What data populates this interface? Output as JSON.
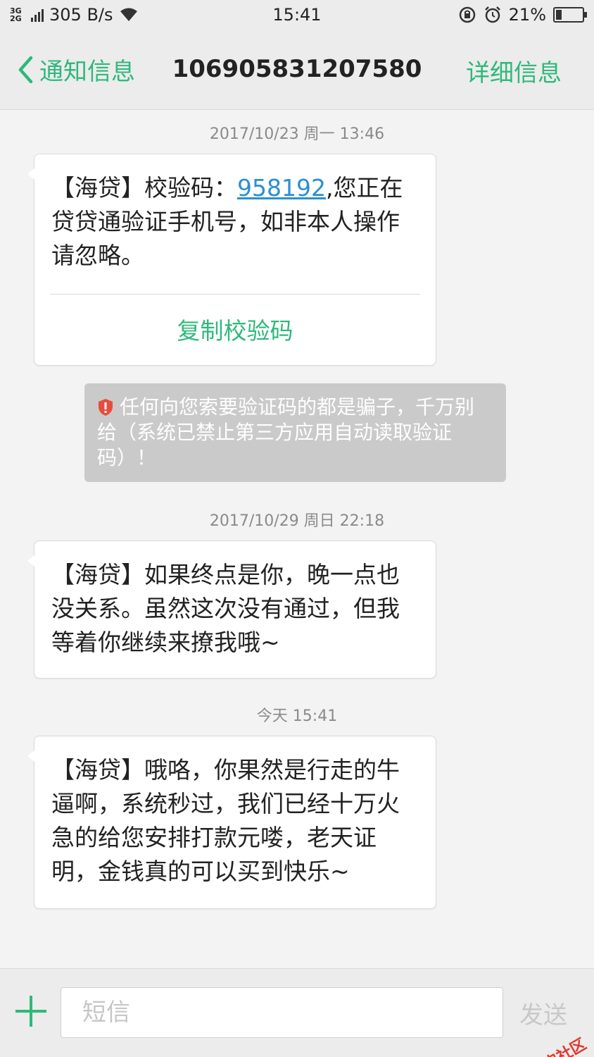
{
  "status_bar": {
    "network_top": "3G",
    "network_bottom": "2G",
    "speed": "305 B/s",
    "time": "15:41",
    "battery": "21%",
    "battery_level": 0.21
  },
  "header": {
    "back_label": "通知信息",
    "title": "106905831207580",
    "detail_label": "详细信息"
  },
  "messages": [
    {
      "timestamp": "2017/10/23 周一 13:46",
      "text_before": "【海贷】校验码：",
      "code": "958192",
      "text_after": ",您正在贷贷通验证手机号，如非本人操作请忽略。",
      "action": "复制校验码"
    },
    {
      "warning": "任何向您索要验证码的都是骗子，千万别给（系统已禁止第三方应用自动读取验证码）！"
    },
    {
      "timestamp": "2017/10/29 周日 22:18",
      "text": "【海贷】如果终点是你，晚一点也没关系。虽然这次没有通过，但我等着你继续来撩我哦~"
    },
    {
      "timestamp": "今天 15:41",
      "text": "【海贷】哦咯，你果然是行走的牛逼啊，系统秒过，我们已经十万火急的给您安排打款元喽，老天证明，金钱真的可以买到快乐~"
    }
  ],
  "input_bar": {
    "placeholder": "短信",
    "send_label": "发送"
  },
  "watermark": "卡农社区",
  "colors": {
    "accent": "#2fb87b",
    "link": "#2a8fd6",
    "warning_bg": "#cacaca",
    "warning_icon": "#e84c3d"
  }
}
